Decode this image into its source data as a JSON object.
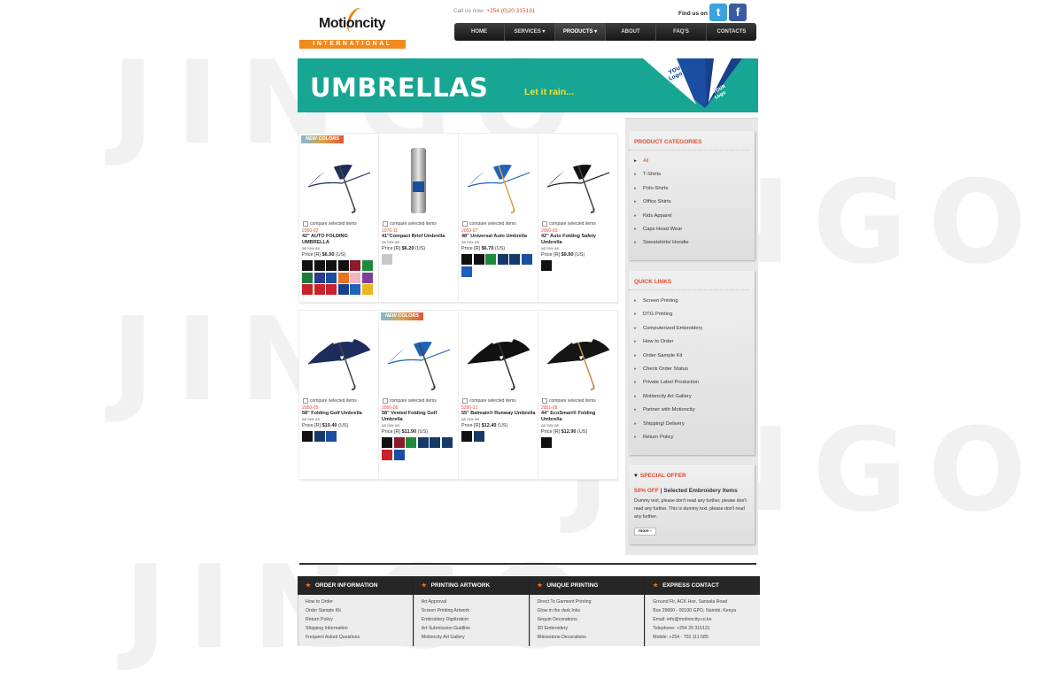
{
  "watermark": "JINGO",
  "header": {
    "logo_name": "Motioncity",
    "logo_sub": "INTERNATIONAL",
    "callus_label": "Call us now:",
    "callus_number": "+254 (0)20 315131",
    "findus": "Find us on",
    "social": {
      "twitter": "t",
      "facebook": "f"
    }
  },
  "nav": [
    "HOME",
    "SERVICES ▾",
    "PRODUCTS ▾",
    "ABOUT",
    "FAQ'S",
    "CONTACTS"
  ],
  "banner": {
    "title": "UMBRELLAS",
    "subtitle": "Let it rain..."
  },
  "compare_label": "compare selected items",
  "new_colors_label": "NEW COLORS",
  "products": [
    {
      "sku": "2050-02",
      "name": "42\" AUTO FOLDING UMBRELLA",
      "aslow": "as low as",
      "price_prefix": "Price [R]",
      "price": "$6.90",
      "price_suffix": "(US)",
      "new": true,
      "icon": "umbrella-navy-white-icon",
      "swatches": [
        "#111111",
        "#111111",
        "#111111",
        "#111111",
        "#8b1a2a",
        "#1f8a3a",
        "#1f7a3c",
        "#2a3a8c",
        "#1a4ea0",
        "#e8731c",
        "#f4b2c0",
        "#7a3f96",
        "#c8222b",
        "#c8222b",
        "#c8222b",
        "#1a3f8a",
        "#1e63b8",
        "#e8b81c"
      ]
    },
    {
      "sku": "1970-11",
      "name": "41\"Compact Brief Umbrella",
      "aslow": "as low as",
      "price_prefix": "Price [R]",
      "price": "$6.20",
      "price_suffix": "(US)",
      "new": false,
      "icon": "umbrella-sleeve-icon",
      "swatches": [
        "#c8c8c8"
      ]
    },
    {
      "sku": "2050-07",
      "name": "48\" Universal Auto Umbrella",
      "aslow": "as low as",
      "price_prefix": "Price [R]",
      "price": "$6.70",
      "price_suffix": "(US)",
      "new": false,
      "icon": "umbrella-blue-white-icon",
      "swatches": [
        "#111111",
        "#111111",
        "#1f8a3a",
        "#153a6a",
        "#153a6a",
        "#1a4ea0",
        "#1e5fb8"
      ]
    },
    {
      "sku": "2050-03",
      "name": "42\" Auto Folding Safety Umbrella",
      "aslow": "as low as",
      "price_prefix": "Price [R]",
      "price": "$9.90",
      "price_suffix": "(US)",
      "new": false,
      "icon": "umbrella-black-white-icon",
      "swatches": [
        "#111111"
      ]
    },
    {
      "sku": "2050-05",
      "name": "58\" Folding Golf Umbrella",
      "aslow": "as low as",
      "price_prefix": "Price [R]",
      "price": "$10.40",
      "price_suffix": "(US)",
      "new": false,
      "icon": "umbrella-navy-icon",
      "swatches": [
        "#111111",
        "#153a6a",
        "#1a4ea0"
      ]
    },
    {
      "sku": "2050-06",
      "name": "58\" Vented Folding Golf Umbrella",
      "aslow": "as low as",
      "price_prefix": "Price [R]",
      "price": "$11.90",
      "price_suffix": "(US)",
      "new": true,
      "icon": "umbrella-vented-blue-icon",
      "swatches": [
        "#111111",
        "#8b1a2a",
        "#1f8a3a",
        "#153a6a",
        "#153a6a",
        "#153a6a",
        "#c8222b",
        "#1a4ea0"
      ]
    },
    {
      "sku": "5290-21",
      "name": "55\" Balmain® Runway Umbrella",
      "aslow": "as low as",
      "price_prefix": "Price [R]",
      "price": "$12.40",
      "price_suffix": "(US)",
      "new": false,
      "icon": "umbrella-black-hook-icon",
      "swatches": [
        "#111111",
        "#153a6a"
      ]
    },
    {
      "sku": "2051-09",
      "name": "44\" EcoSmart® Folding Umbrella",
      "aslow": "as low as",
      "price_prefix": "Price [R]",
      "price": "$12.90",
      "price_suffix": "(US)",
      "new": false,
      "icon": "umbrella-black-wood-icon",
      "swatches": [
        "#111111"
      ]
    }
  ],
  "sidebar": {
    "categories_title": "PRODUCT CATEGORIES",
    "categories": [
      "All",
      "T-Shirts",
      "Polo-Shirts",
      "Office Shirts",
      "Kids Apparel",
      "Caps Head Wear",
      "Sweatshirts/ Hoodie"
    ],
    "quicklinks_title": "QUICK LINKS",
    "quicklinks": [
      "Screen Printing",
      "DTG Printing",
      "Computerized Embroidery",
      "How to Order",
      "Order Sample Kit",
      "Check Order Status",
      "Private Label Production",
      "Motioncity Art Gallery",
      "Partner with Motioncity",
      "Shipping/ Delivery",
      "Return Policy"
    ],
    "offer_title": "SPECIAL OFFER",
    "offer_highlight": "50% OFF",
    "offer_sep": " | ",
    "offer_headline": "Selected Embroidery Items",
    "offer_body": "Dummy text, please don't read any further, please don't read any further. This is dummy text, please don't read any further.",
    "more_label": "more ›"
  },
  "footer": [
    {
      "title": "ORDER INFORMATION",
      "items": [
        "How to Order",
        "Order Sample Kit",
        "Return Policy",
        "Shipping Information",
        "Frequent Asked Questions"
      ]
    },
    {
      "title": "PRINTING ARTWORK",
      "items": [
        "Art Approval",
        "Screen Printing Artwork",
        "Embroidery Digitization",
        "Art Submission Guidline",
        "Motioncity Art Gallery"
      ]
    },
    {
      "title": "UNIQUE PRINTING",
      "items": [
        "Direct To Garment Printing",
        "Glow in the dark Inks",
        "Sequin Decorations",
        "3D Embroidery",
        "Rhinestone Decorations"
      ]
    },
    {
      "title": "EXPRESS CONTACT",
      "items": [
        "Ground Flr, ACK Hse, Sansala Road",
        "Box 29600 - 00100 GPO, Nairobi, Kenya",
        "Email: info@motioncity.co.ke",
        "Telephone: +254 20 315131",
        "Mobile: +254 - 702 111 585"
      ]
    }
  ]
}
